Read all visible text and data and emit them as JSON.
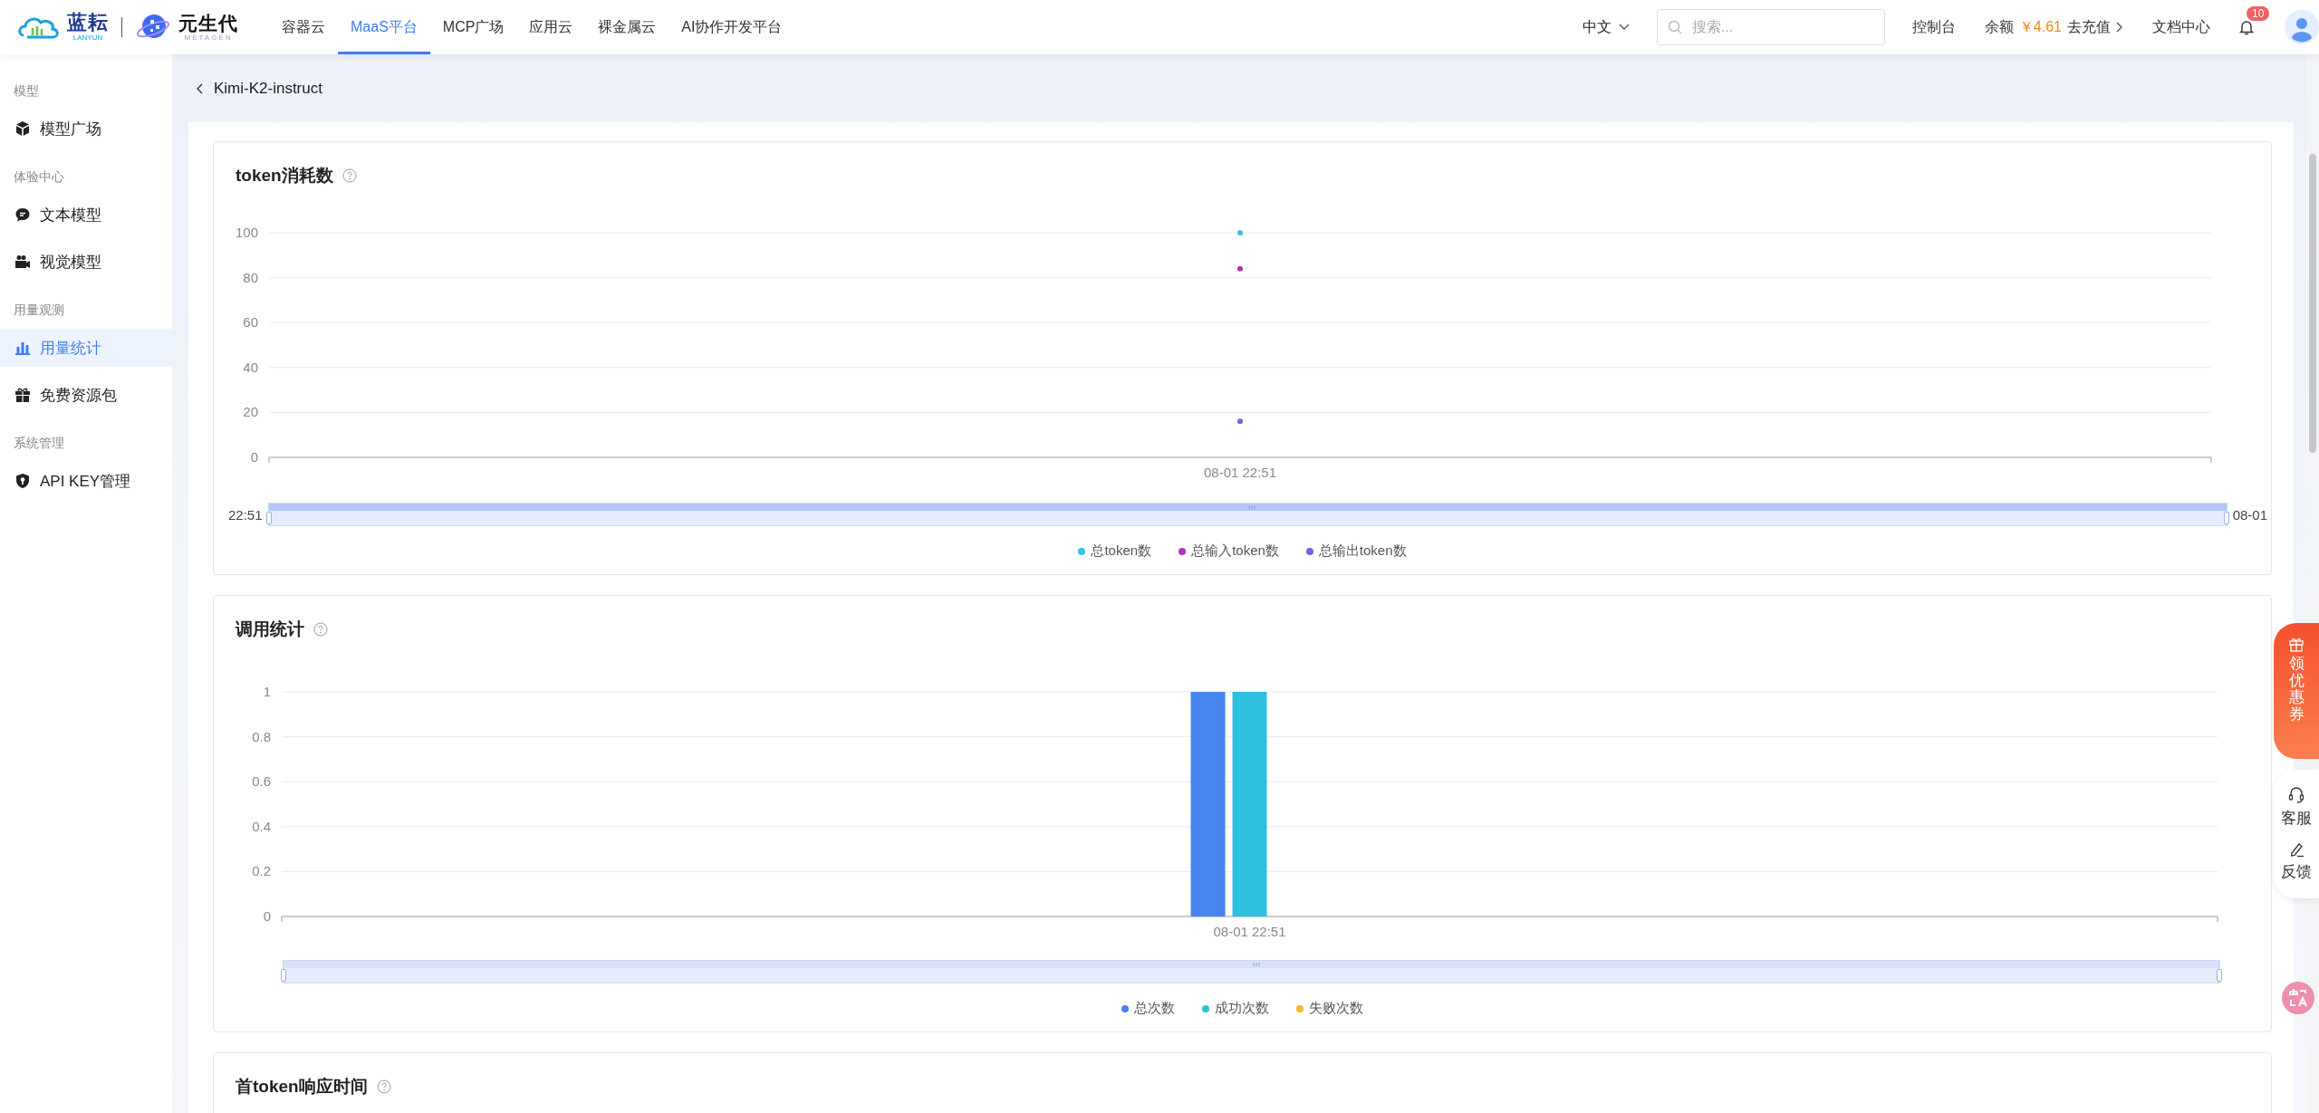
{
  "header": {
    "logo": {
      "brand": "蓝耘",
      "brand_sub": "LANYUN",
      "partner": "元生代",
      "partner_sub": "METAGEN"
    },
    "nav": [
      {
        "label": "容器云",
        "selected": false
      },
      {
        "label": "MaaS平台",
        "selected": true
      },
      {
        "label": "MCP广场",
        "selected": false
      },
      {
        "label": "应用云",
        "selected": false
      },
      {
        "label": "裸金属云",
        "selected": false
      },
      {
        "label": "AI协作开发平台",
        "selected": false
      }
    ],
    "language": "中文",
    "search": {
      "placeholder": "搜索..."
    },
    "console": "控制台",
    "balance": {
      "label": "余额",
      "amount": "￥4.61",
      "action": "去充值"
    },
    "docs": "文档中心",
    "notifications": "10"
  },
  "sidebar": {
    "sections": [
      {
        "title": "模型",
        "items": [
          {
            "label": "模型广场",
            "selected": false
          }
        ]
      },
      {
        "title": "体验中心",
        "items": [
          {
            "label": "文本模型",
            "selected": false
          },
          {
            "label": "视觉模型",
            "selected": false
          }
        ]
      },
      {
        "title": "用量观测",
        "items": [
          {
            "label": "用量统计",
            "selected": true
          },
          {
            "label": "免费资源包",
            "selected": false
          }
        ]
      },
      {
        "title": "系统管理",
        "items": [
          {
            "label": "API KEY管理",
            "selected": false
          }
        ]
      }
    ]
  },
  "breadcrumb": {
    "title": "Kimi-K2-instruct"
  },
  "cards": [
    {
      "title": "token消耗数",
      "range_slider": {
        "level": 1,
        "labels": [
          "22:51",
          "08-01"
        ]
      },
      "chart_data": {
        "type": "line",
        "grid": true,
        "categories": [
          "08-01 22:51"
        ],
        "ylim": [
          0,
          100
        ],
        "yticks": [
          0,
          20,
          40,
          60,
          80,
          100
        ],
        "series": [
          {
            "name": "总token数",
            "color": "#2ec7e0",
            "marker": true,
            "values": [
              100
            ]
          },
          {
            "name": "总输入token数",
            "color": "#b133b5",
            "marker": true,
            "values": [
              84
            ]
          },
          {
            "name": "总输出token数",
            "color": "#7e5de3",
            "marker": true,
            "values": [
              16
            ]
          }
        ]
      }
    },
    {
      "title": "调用统计",
      "range_slider": {
        "level": 1
      },
      "chart_data": {
        "type": "bar",
        "grid": true,
        "categories": [
          "08-01 22:51"
        ],
        "ylim": [
          0,
          1
        ],
        "yticks": [
          0,
          0.2,
          0.4,
          0.6,
          0.8,
          1
        ],
        "series": [
          {
            "name": "总次数",
            "color": "#4785f0",
            "values": [
              1
            ]
          },
          {
            "name": "成功次数",
            "color": "#2ebfe0",
            "values": [
              1
            ]
          },
          {
            "name": "失败次数",
            "color": "#f7b731",
            "values": [
              0
            ]
          }
        ]
      }
    },
    {
      "title": "首token响应时间"
    }
  ],
  "floating": {
    "coupon": "领优惠券",
    "service": "客服",
    "feedback": "反馈"
  }
}
